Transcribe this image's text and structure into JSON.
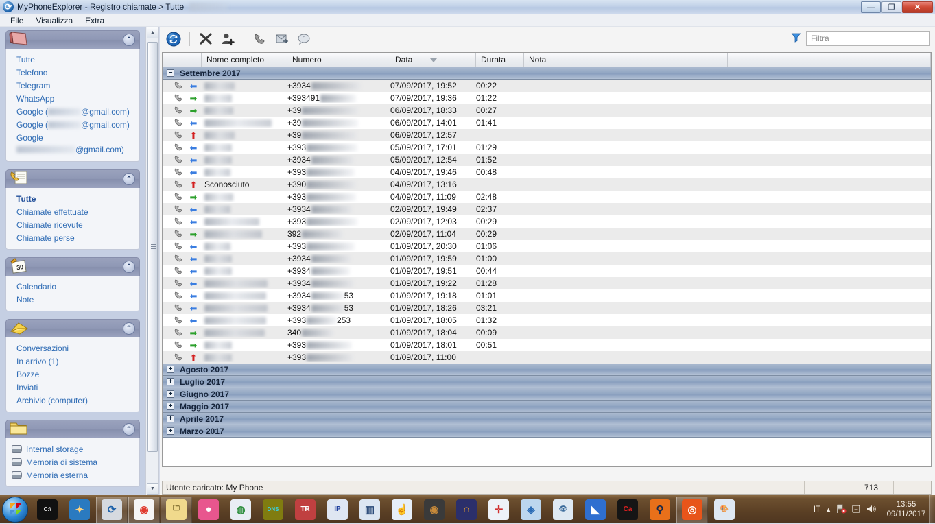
{
  "window": {
    "title": "MyPhoneExplorer -  Registro chiamate > Tutte",
    "icon": "sync-icon",
    "buttons": {
      "minimize": "—",
      "restore": "❐",
      "close": "✕"
    }
  },
  "menubar": {
    "items": [
      "File",
      "Visualizza",
      "Extra"
    ]
  },
  "sidebar": {
    "panels": [
      {
        "title": "Rubrica",
        "icon": "address-book-icon",
        "collapse_icon": "chevron-up-icon",
        "items": [
          {
            "label": "Tutte",
            "selected": false
          },
          {
            "label": "Telefono",
            "selected": false
          },
          {
            "label": "Telegram",
            "selected": false
          },
          {
            "label": "WhatsApp",
            "selected": false
          },
          {
            "label": "Google (",
            "redacted": true,
            "suffix": "@gmail.com)"
          },
          {
            "label": "Google (",
            "redacted": true,
            "suffix": "@gmail.com)"
          },
          {
            "label": "Google",
            "redacted": true,
            "suffix": "@gmail.com)",
            "wrap": true
          }
        ]
      },
      {
        "title": "Registro chiamate",
        "icon": "call-log-icon",
        "collapse_icon": "chevron-up-icon",
        "items": [
          {
            "label": "Tutte",
            "selected": true
          },
          {
            "label": "Chiamate effettuate",
            "selected": false
          },
          {
            "label": "Chiamate ricevute",
            "selected": false
          },
          {
            "label": "Chiamate perse",
            "selected": false
          }
        ]
      },
      {
        "title": "Agenda",
        "icon": "calendar-icon",
        "collapse_icon": "chevron-up-icon",
        "items": [
          {
            "label": "Calendario",
            "selected": false
          },
          {
            "label": "Note",
            "selected": false
          }
        ]
      },
      {
        "title": "Messaggi",
        "icon": "envelope-icon",
        "collapse_icon": "chevron-up-icon",
        "items": [
          {
            "label": "Conversazioni",
            "selected": false
          },
          {
            "label": "In arrivo (1)",
            "selected": false
          },
          {
            "label": "Bozze",
            "selected": false
          },
          {
            "label": "Inviati",
            "selected": false
          },
          {
            "label": "Archivio (computer)",
            "selected": false
          }
        ]
      },
      {
        "title": "Esplora",
        "icon": "folder-icon",
        "collapse_icon": "chevron-up-icon",
        "items": [
          {
            "label": "Internal storage",
            "icon": "disc-icon"
          },
          {
            "label": "Memoria di sistema",
            "icon": "disc-icon"
          },
          {
            "label": "Memoria esterna",
            "icon": "disc-icon"
          }
        ]
      }
    ]
  },
  "toolbar": {
    "buttons": [
      {
        "name": "refresh-icon",
        "glyph": "⟳",
        "title": "Aggiorna"
      },
      {
        "name": "delete-icon",
        "glyph": "✖",
        "title": "Elimina"
      },
      {
        "name": "add-contact-icon",
        "glyph": "👤",
        "title": "Aggiungi contatto"
      },
      {
        "name": "call-icon",
        "glyph": "✆",
        "title": "Chiama"
      },
      {
        "name": "send-message-icon",
        "glyph": "✉",
        "title": "Invia messaggio"
      },
      {
        "name": "chat-icon",
        "glyph": "💬",
        "title": "Chat"
      }
    ],
    "filter": {
      "icon": "funnel-icon",
      "placeholder": "Filtra",
      "value": ""
    }
  },
  "grid": {
    "columns": [
      "",
      "",
      "Nome completo",
      "Numero",
      "Data",
      "Durata",
      "Nota"
    ],
    "sort_column": "Data",
    "sort_direction": "desc",
    "groups": [
      {
        "label": "Settembre 2017",
        "expanded": true,
        "toggle": "−",
        "rows": [
          {
            "direction": "in",
            "name": "",
            "name_redacted": true,
            "name_w": 44,
            "number": "+3934",
            "number_redacted": true,
            "number_w": 72,
            "date": "07/09/2017, 19:52",
            "duration": "00:22",
            "note": ""
          },
          {
            "direction": "out",
            "name": "",
            "name_redacted": true,
            "name_w": 40,
            "number": "+393491",
            "number_redacted": true,
            "number_w": 52,
            "date": "07/09/2017, 19:36",
            "duration": "01:22",
            "note": ""
          },
          {
            "direction": "out",
            "name": "",
            "name_redacted": true,
            "name_w": 42,
            "number": "+39",
            "number_redacted": true,
            "number_w": 82,
            "date": "06/09/2017, 18:33",
            "duration": "00:27",
            "note": ""
          },
          {
            "direction": "in",
            "name": "",
            "name_redacted": true,
            "name_w": 98,
            "number": "+39",
            "number_redacted": true,
            "number_w": 82,
            "date": "06/09/2017, 14:01",
            "duration": "01:41",
            "note": ""
          },
          {
            "direction": "miss",
            "name": "",
            "name_redacted": true,
            "name_w": 44,
            "number": "+39",
            "number_redacted": true,
            "number_w": 80,
            "date": "06/09/2017, 12:57",
            "duration": "",
            "note": ""
          },
          {
            "direction": "in",
            "name": "",
            "name_redacted": true,
            "name_w": 40,
            "number": "+393",
            "number_redacted": true,
            "number_w": 74,
            "date": "05/09/2017, 17:01",
            "duration": "01:29",
            "note": ""
          },
          {
            "direction": "in",
            "name": "",
            "name_redacted": true,
            "name_w": 40,
            "number": "+3934",
            "number_redacted": true,
            "number_w": 62,
            "date": "05/09/2017, 12:54",
            "duration": "01:52",
            "note": ""
          },
          {
            "direction": "in",
            "name": "",
            "name_redacted": true,
            "name_w": 38,
            "number": "+393",
            "number_redacted": true,
            "number_w": 70,
            "date": "04/09/2017, 19:46",
            "duration": "00:48",
            "note": ""
          },
          {
            "direction": "miss",
            "name": "Sconosciuto",
            "name_redacted": false,
            "number": "+390",
            "number_redacted": true,
            "number_w": 72,
            "date": "04/09/2017, 13:16",
            "duration": "",
            "note": ""
          },
          {
            "direction": "out",
            "name": "",
            "name_redacted": true,
            "name_w": 42,
            "number": "+393",
            "number_redacted": true,
            "number_w": 72,
            "date": "04/09/2017, 11:09",
            "duration": "02:48",
            "note": ""
          },
          {
            "direction": "in",
            "name": "",
            "name_redacted": true,
            "name_w": 38,
            "number": "+3934",
            "number_redacted": true,
            "number_w": 60,
            "date": "02/09/2017, 19:49",
            "duration": "02:37",
            "note": ""
          },
          {
            "direction": "in",
            "name": "",
            "name_redacted": true,
            "name_w": 80,
            "number": "+393",
            "number_redacted": true,
            "number_w": 74,
            "date": "02/09/2017, 12:03",
            "duration": "00:29",
            "note": ""
          },
          {
            "direction": "out",
            "name": "",
            "name_redacted": true,
            "name_w": 84,
            "number": "392",
            "number_redacted": true,
            "number_w": 60,
            "date": "02/09/2017, 11:04",
            "duration": "00:29",
            "note": ""
          },
          {
            "direction": "in",
            "name": "",
            "name_redacted": true,
            "name_w": 38,
            "number": "+393",
            "number_redacted": true,
            "number_w": 70,
            "date": "01/09/2017, 20:30",
            "duration": "01:06",
            "note": ""
          },
          {
            "direction": "in",
            "name": "",
            "name_redacted": true,
            "name_w": 40,
            "number": "+3934",
            "number_redacted": true,
            "number_w": 58,
            "date": "01/09/2017, 19:59",
            "duration": "01:00",
            "note": ""
          },
          {
            "direction": "in",
            "name": "",
            "name_redacted": true,
            "name_w": 40,
            "number": "+3934",
            "number_redacted": true,
            "number_w": 56,
            "date": "01/09/2017, 19:51",
            "duration": "00:44",
            "note": ""
          },
          {
            "direction": "in",
            "name": "",
            "name_redacted": true,
            "name_w": 92,
            "number": "+3934",
            "number_redacted": true,
            "number_w": 62,
            "date": "01/09/2017, 19:22",
            "duration": "01:28",
            "note": ""
          },
          {
            "direction": "in",
            "name": "",
            "name_redacted": true,
            "name_w": 90,
            "number": "+3934",
            "number_redacted": true,
            "number_w": 48,
            "number_tail": "53",
            "date": "01/09/2017, 19:18",
            "duration": "01:01",
            "note": ""
          },
          {
            "direction": "in",
            "name": "",
            "name_redacted": true,
            "name_w": 92,
            "number": "+3934",
            "number_redacted": true,
            "number_w": 48,
            "number_tail": "53",
            "date": "01/09/2017, 18:26",
            "duration": "03:21",
            "note": ""
          },
          {
            "direction": "in",
            "name": "",
            "name_redacted": true,
            "name_w": 90,
            "number": "+393",
            "number_redacted": true,
            "number_w": 44,
            "number_tail": "253",
            "date": "01/09/2017, 18:05",
            "duration": "01:32",
            "note": ""
          },
          {
            "direction": "out",
            "name": "",
            "name_redacted": true,
            "name_w": 88,
            "number": "340",
            "number_redacted": true,
            "number_w": 46,
            "date": "01/09/2017, 18:04",
            "duration": "00:09",
            "note": ""
          },
          {
            "direction": "out",
            "name": "",
            "name_redacted": true,
            "name_w": 40,
            "number": "+393",
            "number_redacted": true,
            "number_w": 66,
            "date": "01/09/2017, 18:01",
            "duration": "00:51",
            "note": ""
          },
          {
            "direction": "miss",
            "name": "",
            "name_redacted": true,
            "name_w": 40,
            "number": "+393",
            "number_redacted": true,
            "number_w": 68,
            "date": "01/09/2017, 11:00",
            "duration": "",
            "note": ""
          }
        ]
      },
      {
        "label": "Agosto 2017",
        "expanded": false,
        "toggle": "+",
        "rows": []
      },
      {
        "label": "Luglio 2017",
        "expanded": false,
        "toggle": "+",
        "rows": []
      },
      {
        "label": "Giugno 2017",
        "expanded": false,
        "toggle": "+",
        "rows": []
      },
      {
        "label": "Maggio 2017",
        "expanded": false,
        "toggle": "+",
        "rows": []
      },
      {
        "label": "Aprile 2017",
        "expanded": false,
        "toggle": "+",
        "rows": []
      },
      {
        "label": "Marzo 2017",
        "expanded": false,
        "toggle": "+",
        "rows": []
      }
    ]
  },
  "statusbar": {
    "message": "Utente caricato: My Phone",
    "count": "713"
  },
  "taskbar": {
    "start": "start-orb",
    "items": [
      {
        "name": "command-prompt-icon",
        "glyph": "C:\\",
        "color": "#111",
        "fg": "#ddd"
      },
      {
        "name": "compass-icon",
        "glyph": "✦",
        "color": "#2a7ac0",
        "fg": "#ffd27f"
      },
      {
        "name": "myphoneexplorer-icon",
        "glyph": "⟳",
        "color": "#d6dae0",
        "fg": "#1a5fa8",
        "active": true
      },
      {
        "name": "google-chrome-icon",
        "glyph": "◉",
        "color": "#f5f5f5",
        "fg": "#e03b2f",
        "active": true
      },
      {
        "name": "file-explorer-icon",
        "glyph": "🗀",
        "color": "#f0d98c",
        "fg": "#6b5a1e",
        "active": true
      },
      {
        "name": "pink-app-icon",
        "glyph": "●",
        "color": "#e8568e",
        "fg": "#ffffff"
      },
      {
        "name": "browser-globe-icon",
        "glyph": "◍",
        "color": "#e9eef5",
        "fg": "#2f8f3f"
      },
      {
        "name": "dns-tool-icon",
        "glyph": "DNS",
        "color": "#807c10",
        "fg": "#3ad1e0"
      },
      {
        "name": "tor-icon",
        "glyph": "TR",
        "color": "#c04040",
        "fg": "#ffffff"
      },
      {
        "name": "ip-tool-icon",
        "glyph": "IP",
        "color": "#dfe6f2",
        "fg": "#1f3f9e"
      },
      {
        "name": "window-tool-icon",
        "glyph": "▥",
        "color": "#dce6f2",
        "fg": "#2a4a78"
      },
      {
        "name": "pointer-window-icon",
        "glyph": "☝",
        "color": "#e6eef8",
        "fg": "#244a7c"
      },
      {
        "name": "eye-dark-icon",
        "glyph": "◉",
        "color": "#3a3a3a",
        "fg": "#c78a3a"
      },
      {
        "name": "headphones-icon",
        "glyph": "∩",
        "color": "#2b2f6b",
        "fg": "#f0a32a"
      },
      {
        "name": "document-shield-icon",
        "glyph": "✛",
        "color": "#eef2f8",
        "fg": "#d03030"
      },
      {
        "name": "update-shield-icon",
        "glyph": "◈",
        "color": "#bcd6ee",
        "fg": "#2a6bb5"
      },
      {
        "name": "eye-light-icon",
        "glyph": "👁",
        "color": "#dfe9f2",
        "fg": "#3a6a9a"
      },
      {
        "name": "wireshark-icon",
        "glyph": "◣",
        "color": "#2f6fd0",
        "fg": "#ffffff"
      },
      {
        "name": "cars-app-icon",
        "glyph": "Ca",
        "color": "#151515",
        "fg": "#e02020"
      },
      {
        "name": "openvpn-icon",
        "glyph": "⚲",
        "color": "#e8701a",
        "fg": "#1a2a4a"
      },
      {
        "name": "capture-icon",
        "glyph": "◎",
        "color": "#e8551a",
        "fg": "#ffffff",
        "active": true
      },
      {
        "name": "paint-palette-icon",
        "glyph": "🎨",
        "color": "#dfe8f2",
        "fg": "#3a6a9a"
      }
    ],
    "tray": {
      "language": "IT",
      "expand_icon": "chevron-up-icon",
      "network_icon": "network-error-icon",
      "action_center_icon": "flag-icon",
      "volume_icon": "speaker-icon",
      "time": "13:55",
      "date": "09/11/2017"
    }
  }
}
